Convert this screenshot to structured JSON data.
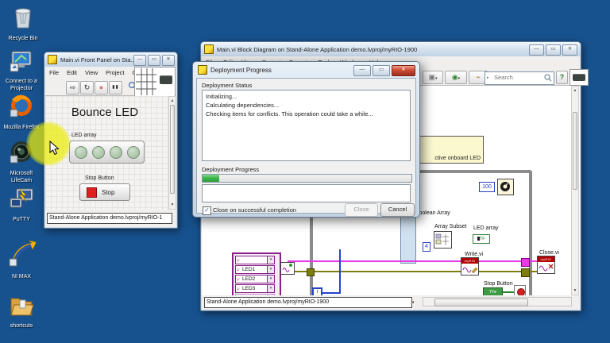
{
  "desktop": {
    "icons": [
      {
        "label": "Recycle Bin"
      },
      {
        "label": "Connect to a Projector"
      },
      {
        "label": "Mozilla Firefox"
      },
      {
        "label": "Microsoft LifeCam"
      },
      {
        "label": "PuTTY"
      },
      {
        "label": "NI MAX"
      },
      {
        "label": "shortcuts"
      }
    ]
  },
  "front_panel": {
    "title": "Main.vi Front Panel on Sta...",
    "menus": [
      "File",
      "Edit",
      "View",
      "Project",
      "Operate"
    ],
    "panel_title": "Bounce LED",
    "led_array_label": "LED array",
    "stop_button_label": "Stop Button",
    "stop_button_text": "Stop",
    "status_bar": "Stand-Alone Application demo.lvproj/myRIO-1"
  },
  "block_diagram": {
    "title": "Main.vi Block Diagram on Stand-Alone Application demo.lvproj/myRIO-1900",
    "menus": [
      "File",
      "Edit",
      "View",
      "Project",
      "Operate",
      "Tools",
      "Window",
      "Help"
    ],
    "search_placeholder": "Search",
    "comment": "ctive onboard LED",
    "wait_constant": "100",
    "bool_array_label": "o Boolean Array",
    "array_subset_label": "Array Subset",
    "index_constant": "4",
    "led_array_label": "LED array",
    "write_vi_label": "Write.vi",
    "close_vi_label": "Close.vi",
    "myrio_banner": "myRIO",
    "stop_button_label": "Stop Button",
    "iteration_terminal": "i",
    "tf_glyph": "TF",
    "channels": [
      "LED1",
      "LED2",
      "LED3"
    ],
    "status_bar": "Stand-Alone Application demo.lvproj/myRIO-1900"
  },
  "deployment_dialog": {
    "title": "Deployment Progress",
    "status_label": "Deployment Status",
    "status_lines": [
      "Initializing...",
      "Calculating dependencies...",
      "Checking items for conflicts. This operation could take a while..."
    ],
    "progress_label": "Deployment Progress",
    "progress_percent": 8,
    "checkbox_label": "Close on successful completion",
    "close_button": "Close",
    "cancel_button": "Cancel"
  },
  "colors": {
    "desktop_bg": "#17528f",
    "progress_green": "#3cb44a",
    "wire_pink": "#e93ae9",
    "wire_olive": "#7e7e10",
    "io_purple": "#8a1e8a"
  }
}
